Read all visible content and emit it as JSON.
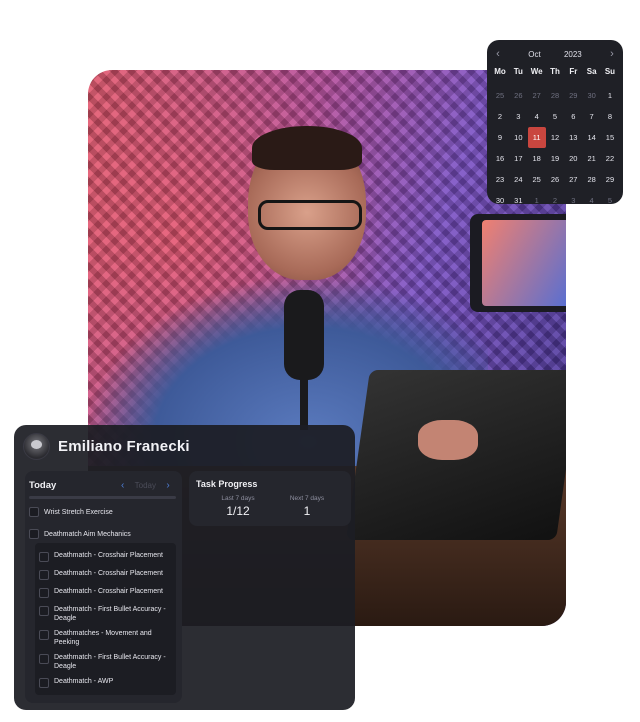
{
  "calendar": {
    "month": "Oct",
    "year": "2023",
    "prev_icon": "‹",
    "next_icon": "›",
    "weekdays": [
      "Mo",
      "Tu",
      "We",
      "Th",
      "Fr",
      "Sa",
      "Su"
    ],
    "days": [
      {
        "n": "25",
        "muted": true
      },
      {
        "n": "26",
        "muted": true
      },
      {
        "n": "27",
        "muted": true
      },
      {
        "n": "28",
        "muted": true
      },
      {
        "n": "29",
        "muted": true
      },
      {
        "n": "30",
        "muted": true
      },
      {
        "n": "1"
      },
      {
        "n": "2"
      },
      {
        "n": "3"
      },
      {
        "n": "4"
      },
      {
        "n": "5"
      },
      {
        "n": "6"
      },
      {
        "n": "7"
      },
      {
        "n": "8"
      },
      {
        "n": "9"
      },
      {
        "n": "10"
      },
      {
        "n": "11",
        "selected": true
      },
      {
        "n": "12"
      },
      {
        "n": "13"
      },
      {
        "n": "14"
      },
      {
        "n": "15"
      },
      {
        "n": "16"
      },
      {
        "n": "17"
      },
      {
        "n": "18"
      },
      {
        "n": "19"
      },
      {
        "n": "20"
      },
      {
        "n": "21"
      },
      {
        "n": "22"
      },
      {
        "n": "23"
      },
      {
        "n": "24"
      },
      {
        "n": "25"
      },
      {
        "n": "26"
      },
      {
        "n": "27"
      },
      {
        "n": "28"
      },
      {
        "n": "29"
      },
      {
        "n": "30"
      },
      {
        "n": "31"
      },
      {
        "n": "1",
        "muted": true
      },
      {
        "n": "2",
        "muted": true
      },
      {
        "n": "3",
        "muted": true
      },
      {
        "n": "4",
        "muted": true
      },
      {
        "n": "5",
        "muted": true
      }
    ],
    "accent_color": "#c9463f"
  },
  "profile": {
    "name": "Emiliano Franecki"
  },
  "today": {
    "title": "Today",
    "prev_icon": "‹",
    "next_icon": "›",
    "today_label": "Today",
    "top_task": "Wrist Stretch Exercise",
    "parent_task": "Deathmatch Aim Mechanics",
    "subtasks": [
      "Deathmatch - Crosshair Placement",
      "Deathmatch - Crosshair Placement",
      "Deathmatch - Crosshair Placement",
      "Deathmatch - First Bullet Accuracy - Deagle",
      "Deathmatches - Movement and Peeking",
      "Deathmatch - First Bullet Accuracy - Deagle",
      "Deathmatch - AWP"
    ]
  },
  "progress": {
    "title": "Task Progress",
    "last_label": "Last 7 days",
    "last_value": "1/12",
    "next_label": "Next 7 days",
    "next_value": "1"
  }
}
